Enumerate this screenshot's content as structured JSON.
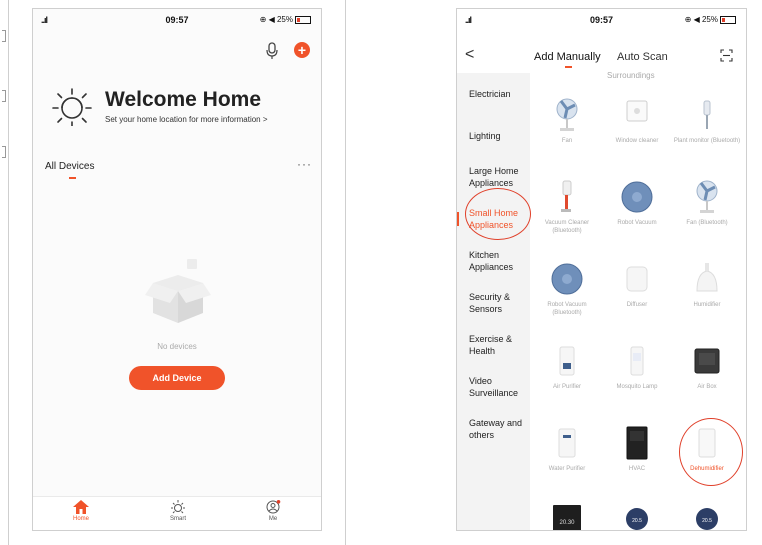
{
  "status_bar": {
    "signal": "..ıl",
    "time": "09:57",
    "battery": "25%"
  },
  "home": {
    "welcome_title": "Welcome Home",
    "welcome_subtitle": "Set your home location for more information  >",
    "all_devices_label": "All Devices",
    "more_label": "···",
    "empty_text": "No devices",
    "add_device_label": "Add Device",
    "tabs": [
      {
        "label": "Home",
        "icon": "home-icon"
      },
      {
        "label": "Smart",
        "icon": "sun-icon"
      },
      {
        "label": "Me",
        "icon": "profile-icon"
      }
    ]
  },
  "add_device": {
    "back_label": "<",
    "tab_manual": "Add Manually",
    "tab_scan": "Auto Scan",
    "section_title": "Surroundings",
    "categories": [
      {
        "label": "Electrician"
      },
      {
        "label": "Lighting"
      },
      {
        "label": "Large Home Appliances"
      },
      {
        "label": "Small Home Appliances"
      },
      {
        "label": "Kitchen Appliances"
      },
      {
        "label": "Security & Sensors"
      },
      {
        "label": "Exercise & Health"
      },
      {
        "label": "Video Surveillance"
      },
      {
        "label": "Gateway and others"
      }
    ],
    "devices": [
      {
        "label": "Fan",
        "icon": "fan-icon"
      },
      {
        "label": "Window cleaner",
        "icon": "window-cleaner-icon"
      },
      {
        "label": "Plant monitor (Bluetooth)",
        "icon": "plant-monitor-icon"
      },
      {
        "label": "Vacuum Cleaner (Bluetooth)",
        "icon": "vacuum-cleaner-icon"
      },
      {
        "label": "Robot Vacuum",
        "icon": "robot-vacuum-icon"
      },
      {
        "label": "Fan (Bluetooth)",
        "icon": "fan-icon"
      },
      {
        "label": "Robot Vacuum (Bluetooth)",
        "icon": "robot-vacuum-icon"
      },
      {
        "label": "Diffuser",
        "icon": "diffuser-icon"
      },
      {
        "label": "Humidifier",
        "icon": "humidifier-icon"
      },
      {
        "label": "Air Purifier",
        "icon": "air-purifier-icon"
      },
      {
        "label": "Mosquito Lamp",
        "icon": "mosquito-lamp-icon"
      },
      {
        "label": "Air Box",
        "icon": "air-box-icon"
      },
      {
        "label": "Water Purifier",
        "icon": "water-purifier-icon"
      },
      {
        "label": "HVAC",
        "icon": "hvac-icon"
      },
      {
        "label": "Dehumidifier",
        "icon": "dehumidifier-icon"
      },
      {
        "label": "20.30",
        "icon": "thermostat-icon"
      },
      {
        "label": "20.5",
        "icon": "thermostat-round-icon"
      },
      {
        "label": "20.5",
        "icon": "thermostat-round-icon"
      }
    ]
  },
  "colors": {
    "accent": "#f0532a",
    "annotation": "#e0402a"
  }
}
